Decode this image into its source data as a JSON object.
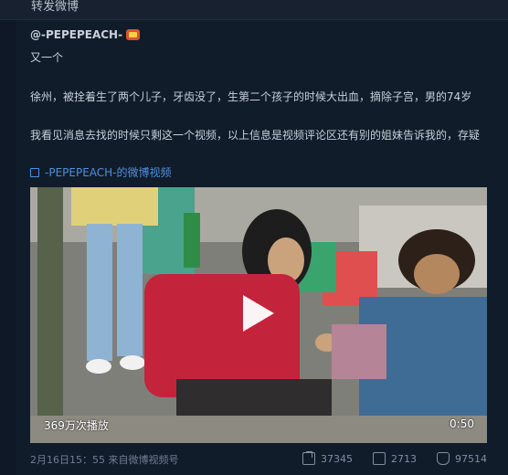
{
  "top_bar": {
    "title": "转发微博"
  },
  "post": {
    "author": "@-PEPEPEACH-",
    "lines": [
      "又一个",
      "徐州，被拴着生了两个儿子，牙齿没了，生第二个孩子的时候大出血，摘除子宫，男的74岁",
      "我看见消息去找的时候只剩这一个视频，以上信息是视频评论区还有别的姐妹告诉我的，存疑"
    ],
    "video_link": "-PEPEPEACH-的微博视频"
  },
  "video": {
    "views": "369万次播放",
    "duration": "0:50",
    "icons": {
      "play": "play-icon"
    }
  },
  "footer": {
    "meta": "2月16日15：55 来自微博视频号",
    "shares": "37345",
    "comments": "2713",
    "likes": "97514",
    "icons": {
      "share": "share-icon",
      "comment": "comment-icon",
      "like": "like-icon"
    }
  }
}
